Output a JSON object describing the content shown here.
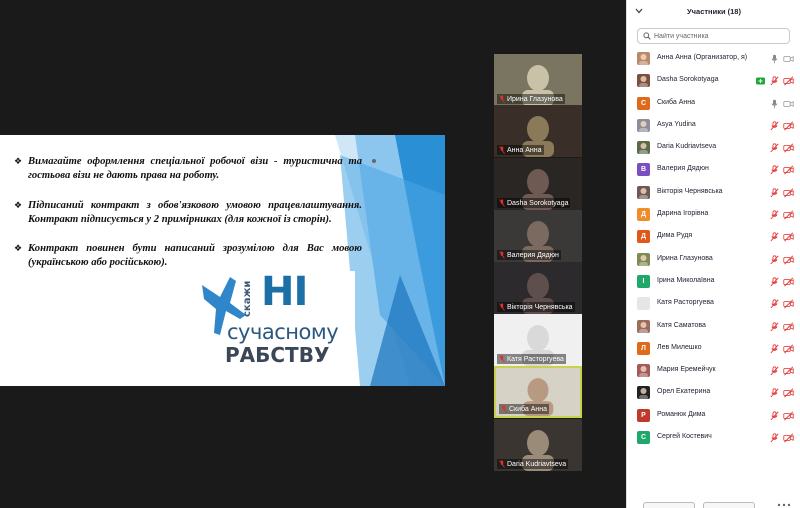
{
  "slide": {
    "bullets": [
      "Вимагайте   оформлення  спеціальної робочої візи  -  туристична та гостьова візи не дають права на роботу.",
      "Підписаний  контракт з обов'язковою умовою працевлаштування. Контракт підписується у 2 примірниках (для кожної із сторін).",
      "Контракт  повинен  бути  написаний  зрозумілою  для  Вас  мовою (українською або російською)."
    ],
    "bullet_mark": "❖",
    "logo": {
      "say": "скажи",
      "no": "НІ",
      "line2": "сучасному",
      "line3": "РАБСТВУ"
    }
  },
  "video_tiles": [
    {
      "name": "Ирина Глазунова",
      "active": false
    },
    {
      "name": "Анна Анна",
      "active": false
    },
    {
      "name": "Dasha Sorokotyaga",
      "active": false
    },
    {
      "name": "Валерия Дядюн",
      "active": false
    },
    {
      "name": "Вікторія Чернявська",
      "active": false
    },
    {
      "name": "Катя Расторгуева",
      "active": false
    },
    {
      "name": "Скиба Анна",
      "active": true
    },
    {
      "name": "Daria Kudriavtseva",
      "active": false
    }
  ],
  "panel": {
    "title": "Участники (18)",
    "search_placeholder": "Найти участника",
    "participants": [
      {
        "name": "Анна Анна (Организатор, я)",
        "avatar": "photo",
        "color": "#b98a6a",
        "initial": "",
        "mic": "on",
        "cam": "off-gray"
      },
      {
        "name": "Dasha Sorokotyaga",
        "avatar": "photo",
        "color": "#7a5040",
        "initial": "",
        "mic": "muted",
        "cam": "muted",
        "chat": true
      },
      {
        "name": "Скиба Анна",
        "avatar": "letter",
        "color": "#e06a1b",
        "initial": "С",
        "mic": "on",
        "cam": "off-gray"
      },
      {
        "name": "Asya  Yudina",
        "avatar": "photo",
        "color": "#8a8f9a",
        "initial": "",
        "mic": "muted",
        "cam": "muted"
      },
      {
        "name": "Daria Kudriavtseva",
        "avatar": "photo",
        "color": "#5a6a4a",
        "initial": "",
        "mic": "muted",
        "cam": "muted"
      },
      {
        "name": "Валерия Дядюн",
        "avatar": "letter",
        "color": "#7b4fbf",
        "initial": "В",
        "mic": "muted",
        "cam": "muted"
      },
      {
        "name": "Вікторія Чернявська",
        "avatar": "photo",
        "color": "#6d5a55",
        "initial": "",
        "mic": "muted",
        "cam": "muted"
      },
      {
        "name": "Дарина Ігорівна",
        "avatar": "letter",
        "color": "#f08c2a",
        "initial": "Д",
        "mic": "muted",
        "cam": "muted"
      },
      {
        "name": "Дима Рудя",
        "avatar": "letter",
        "color": "#e0591b",
        "initial": "Д",
        "mic": "muted",
        "cam": "muted"
      },
      {
        "name": "Ирина Глазунова",
        "avatar": "photo",
        "color": "#7f8a55",
        "initial": "",
        "mic": "muted",
        "cam": "muted"
      },
      {
        "name": "Ірина Миколаївна",
        "avatar": "letter",
        "color": "#1fa86a",
        "initial": "І",
        "mic": "muted",
        "cam": "muted"
      },
      {
        "name": "Катя Расторгуева",
        "avatar": "blank",
        "color": "#e6e6e6",
        "initial": "",
        "mic": "muted",
        "cam": "muted"
      },
      {
        "name": "Катя Саматова",
        "avatar": "photo",
        "color": "#9a6c5c",
        "initial": "",
        "mic": "muted",
        "cam": "muted"
      },
      {
        "name": "Лев Милешко",
        "avatar": "letter",
        "color": "#e06a1b",
        "initial": "Л",
        "mic": "muted",
        "cam": "muted"
      },
      {
        "name": "Мария Еремейчук",
        "avatar": "photo",
        "color": "#a25a5a",
        "initial": "",
        "mic": "muted",
        "cam": "muted"
      },
      {
        "name": "Орел Екатерина",
        "avatar": "photo",
        "color": "#222222",
        "initial": "",
        "mic": "muted",
        "cam": "muted"
      },
      {
        "name": "Романюк Дима",
        "avatar": "letter",
        "color": "#c0392b",
        "initial": "Р",
        "mic": "muted",
        "cam": "muted"
      },
      {
        "name": "Сергей Костевич",
        "avatar": "letter",
        "color": "#1fa86a",
        "initial": "С",
        "mic": "muted",
        "cam": "muted"
      }
    ]
  },
  "colors": {
    "muted_red": "#e0302f",
    "active_border": "#c8d24a",
    "slide_blue": "#2b8fd6"
  }
}
